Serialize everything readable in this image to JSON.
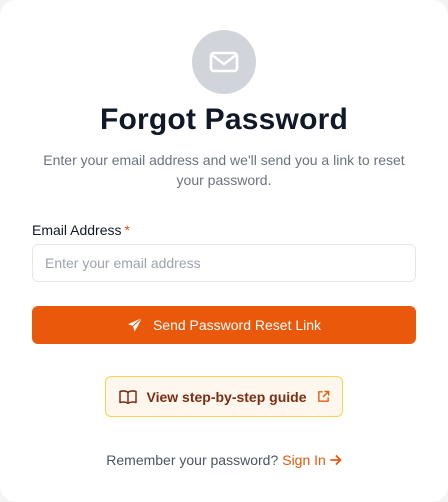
{
  "header": {
    "icon": "envelope-icon",
    "title": "Forgot Password",
    "subtitle": "Enter your email address and we'll send you a link to reset your password."
  },
  "form": {
    "email_label": "Email Address",
    "required_mark": "*",
    "email_value": "",
    "email_placeholder": "Enter your email address",
    "submit_label": "Send Password Reset Link",
    "submit_icon": "paper-plane-icon"
  },
  "guide": {
    "label": "View step-by-step guide",
    "icon": "book-icon",
    "external_icon": "external-link-icon"
  },
  "footer": {
    "prompt": "Remember your password?",
    "signin_label": "Sign In",
    "signin_icon": "arrow-right-icon"
  },
  "colors": {
    "accent": "#ea580c",
    "guide_bg": "#fff7ed",
    "guide_border": "#fcd34d",
    "icon_circle": "#d1d5db"
  }
}
